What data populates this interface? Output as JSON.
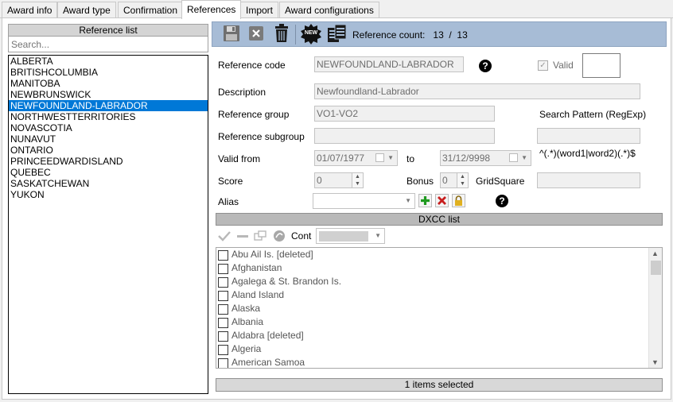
{
  "tabs": [
    {
      "label": "Award info"
    },
    {
      "label": "Award type"
    },
    {
      "label": "Confirmation"
    },
    {
      "label": "References"
    },
    {
      "label": "Import"
    },
    {
      "label": "Award configurations"
    }
  ],
  "reference_list": {
    "title": "Reference list",
    "search_placeholder": "Search...",
    "items": [
      "ALBERTA",
      "BRITISHCOLUMBIA",
      "MANITOBA",
      "NEWBRUNSWICK",
      "NEWFOUNDLAND-LABRADOR",
      "NORTHWESTTERRITORIES",
      "NOVASCOTIA",
      "NUNAVUT",
      "ONTARIO",
      "PRINCEEDWARDISLAND",
      "QUEBEC",
      "SASKATCHEWAN",
      "YUKON"
    ],
    "selected_index": 4
  },
  "toolbar": {
    "new_badge": "NEW",
    "count_label": "Reference count:",
    "count_value": "13  /  13"
  },
  "form": {
    "reference_code_label": "Reference code",
    "reference_code_value": "NEWFOUNDLAND-LABRADOR",
    "valid_label": "Valid",
    "description_label": "Description",
    "description_value": "Newfoundland-Labrador",
    "reference_group_label": "Reference group",
    "reference_group_value": "VO1-VO2",
    "search_pattern_label": "Search Pattern (RegExp)",
    "reference_subgroup_label": "Reference subgroup",
    "reference_subgroup_value": "",
    "valid_from_label": "Valid from",
    "valid_from_value": "01/07/1977",
    "to_label": "to",
    "valid_to_value": "31/12/9998",
    "regexp_hint": "^(.*)(word1|word2)(.*)$",
    "score_label": "Score",
    "score_value": "0",
    "bonus_label": "Bonus",
    "bonus_value": "0",
    "gridsquare_label": "GridSquare",
    "alias_label": "Alias",
    "help_glyph": "?"
  },
  "dxcc": {
    "title": "DXCC list",
    "cont_label": "Cont",
    "items": [
      "Abu Ail Is. [deleted]",
      "Afghanistan",
      "Agalega & St. Brandon Is.",
      "Aland Island",
      "Alaska",
      "Albania",
      "Aldabra [deleted]",
      "Algeria",
      "American Samoa"
    ]
  },
  "status": {
    "text": "1 items selected"
  },
  "colors": {
    "toolbar_bg": "#a7bcd6",
    "selection": "#0078d7"
  }
}
